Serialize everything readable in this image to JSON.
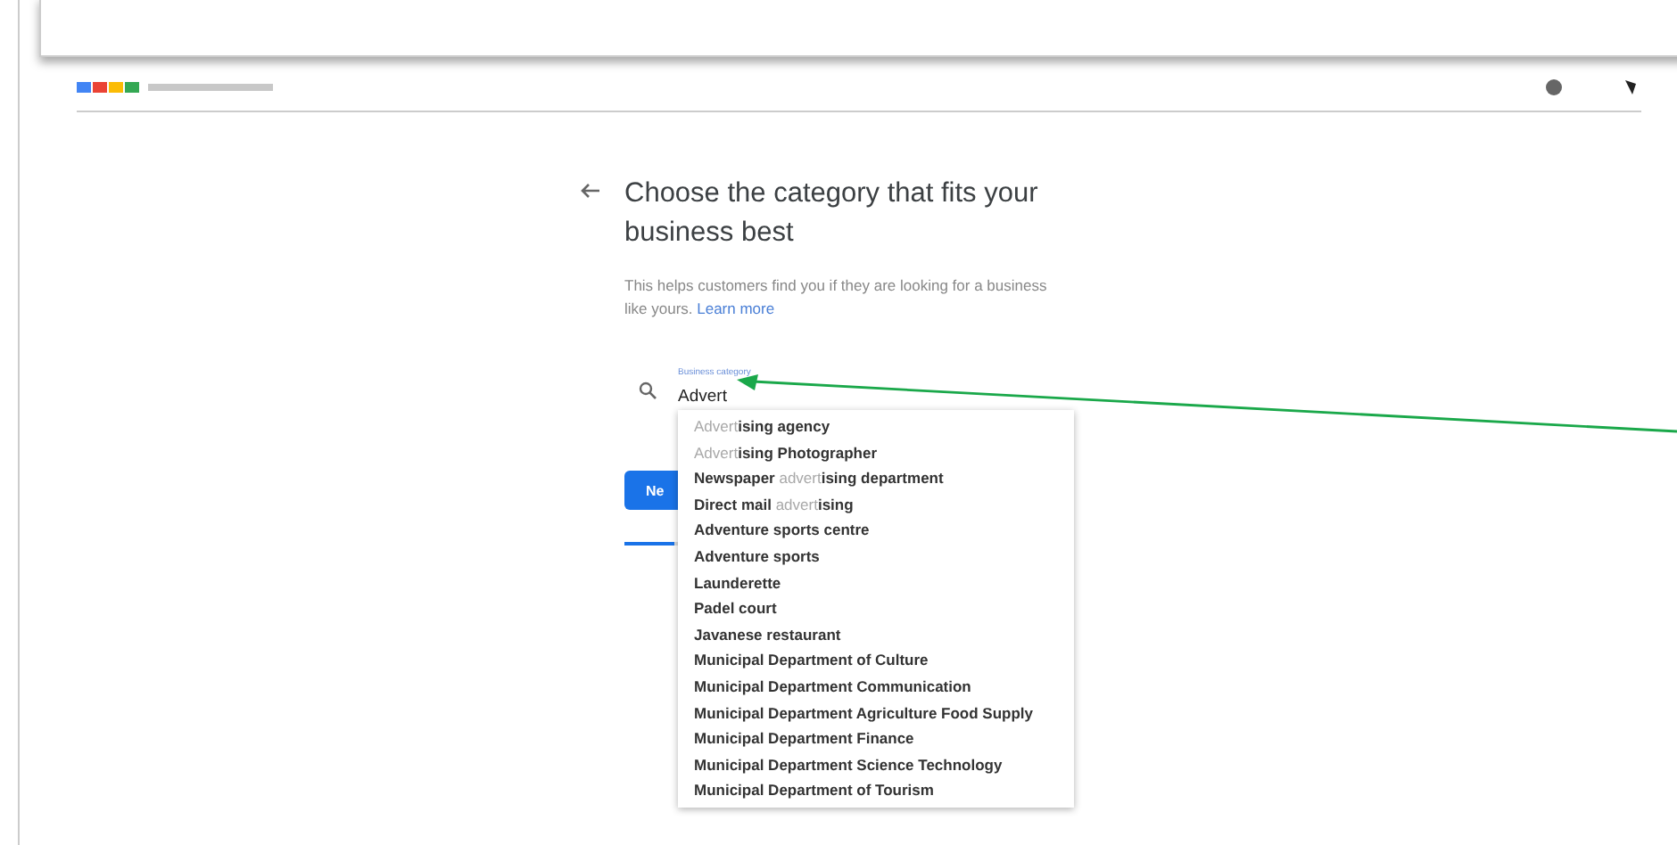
{
  "heading": "Choose the category that fits your business best",
  "description": {
    "text": "This helps customers find you if they are looking for a business like yours.",
    "link": "Learn more"
  },
  "field": {
    "label": "Business category",
    "value": "Advert"
  },
  "suggestions": [
    {
      "parts": [
        {
          "text": "Advert",
          "match": true
        },
        {
          "text": "ising agency",
          "match": false
        }
      ]
    },
    {
      "parts": [
        {
          "text": "Advert",
          "match": true
        },
        {
          "text": "ising Photographer",
          "match": false
        }
      ]
    },
    {
      "parts": [
        {
          "text": "Newspaper ",
          "match": false
        },
        {
          "text": "advert",
          "match": true
        },
        {
          "text": "ising department",
          "match": false
        }
      ]
    },
    {
      "parts": [
        {
          "text": "Direct mail ",
          "match": false
        },
        {
          "text": "advert",
          "match": true
        },
        {
          "text": "ising",
          "match": false
        }
      ]
    },
    {
      "parts": [
        {
          "text": "Adventure sports centre",
          "match": false
        }
      ]
    },
    {
      "parts": [
        {
          "text": "Adventure sports",
          "match": false
        }
      ]
    },
    {
      "parts": [
        {
          "text": "Launderette",
          "match": false
        }
      ]
    },
    {
      "parts": [
        {
          "text": "Padel court",
          "match": false
        }
      ]
    },
    {
      "parts": [
        {
          "text": "Javanese restaurant",
          "match": false
        }
      ]
    },
    {
      "parts": [
        {
          "text": "Municipal Department of Culture",
          "match": false
        }
      ]
    },
    {
      "parts": [
        {
          "text": "Municipal Department Communication",
          "match": false
        }
      ]
    },
    {
      "parts": [
        {
          "text": "Municipal Department Agriculture Food Supply",
          "match": false
        }
      ]
    },
    {
      "parts": [
        {
          "text": "Municipal Department Finance",
          "match": false
        }
      ]
    },
    {
      "parts": [
        {
          "text": "Municipal Department Science Technology",
          "match": false
        }
      ]
    },
    {
      "parts": [
        {
          "text": "Municipal Department of Tourism",
          "match": false
        }
      ]
    }
  ],
  "next_button": "Ne",
  "progress": {
    "level": 0.11
  }
}
